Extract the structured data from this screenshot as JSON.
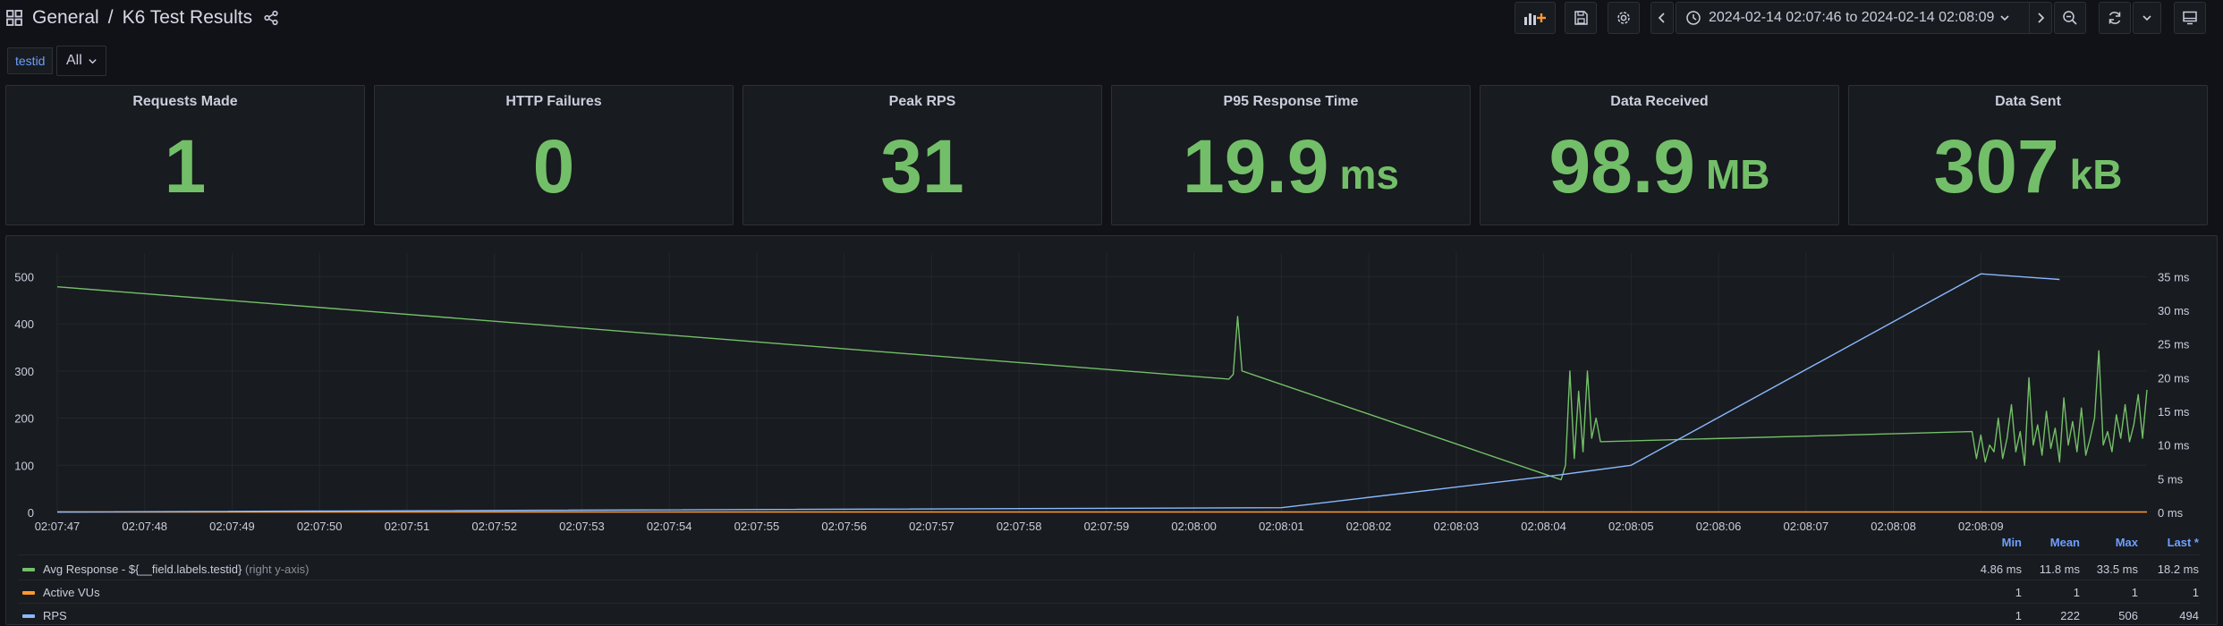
{
  "header": {
    "breadcrumb_folder": "General",
    "breadcrumb_sep": "/",
    "dashboard_title": "K6 Test Results",
    "icons": {
      "grid": "dashboard-grid-icon",
      "share": "share-icon",
      "add_panel": "add-panel-icon",
      "save": "save-icon",
      "settings": "gear-icon",
      "time_back": "chevron-left-icon",
      "clock": "clock-icon",
      "time_forward": "chevron-right-icon",
      "zoom_out": "zoom-out-icon",
      "refresh": "refresh-icon",
      "refresh_menu": "chevron-down-icon",
      "tv_mode": "monitor-icon"
    },
    "time_range": "2024-02-14 02:07:46 to 2024-02-14 02:08:09"
  },
  "variables": {
    "label": "testid",
    "selected": "All"
  },
  "stats": [
    {
      "title": "Requests Made",
      "value": "1",
      "unit": ""
    },
    {
      "title": "HTTP Failures",
      "value": "0",
      "unit": ""
    },
    {
      "title": "Peak RPS",
      "value": "31",
      "unit": ""
    },
    {
      "title": "P95 Response Time",
      "value": "19.9",
      "unit": "ms"
    },
    {
      "title": "Data Received",
      "value": "98.9",
      "unit": "MB"
    },
    {
      "title": "Data Sent",
      "value": "307",
      "unit": "kB"
    }
  ],
  "colors": {
    "green": "#73bf69",
    "blue": "#8ab8ff",
    "orange": "#ff9830",
    "accent": "#6e9fff"
  },
  "chart_data": {
    "type": "line",
    "x_ticks": [
      "02:07:47",
      "02:07:48",
      "02:07:49",
      "02:07:50",
      "02:07:51",
      "02:07:52",
      "02:07:53",
      "02:07:54",
      "02:07:55",
      "02:07:56",
      "02:07:57",
      "02:07:58",
      "02:07:59",
      "02:08:00",
      "02:08:01",
      "02:08:02",
      "02:08:03",
      "02:08:04",
      "02:08:05",
      "02:08:06",
      "02:08:07",
      "02:08:08",
      "02:08:09"
    ],
    "x_range_seconds": [
      47.0,
      70.9
    ],
    "left_axis": {
      "ticks": [
        "0",
        "100",
        "200",
        "300",
        "400",
        "500"
      ],
      "range": [
        0,
        550
      ]
    },
    "right_axis": {
      "ticks": [
        "0 ms",
        "5 ms",
        "10 ms",
        "15 ms",
        "20 ms",
        "25 ms",
        "30 ms",
        "35 ms"
      ],
      "range": [
        0,
        38.5
      ],
      "unit": "ms"
    },
    "grid": true,
    "legend_placement": "bottom",
    "legend_columns": [
      "Min",
      "Mean",
      "Max",
      "Last *"
    ],
    "series": [
      {
        "name": "Avg Response - ${__field.labels.testid}",
        "axis_hint": "(right y-axis)",
        "axis": "right",
        "color": "#73bf69",
        "stats": [
          "4.86 ms",
          "11.8 ms",
          "33.5 ms",
          "18.2 ms"
        ],
        "points": [
          [
            47.0,
            33.5
          ],
          [
            60.4,
            19.8
          ],
          [
            60.45,
            20.5
          ],
          [
            60.5,
            29.1
          ],
          [
            60.55,
            21.0
          ],
          [
            64.2,
            4.86
          ],
          [
            64.25,
            7.0
          ],
          [
            64.3,
            21.0
          ],
          [
            64.35,
            8.0
          ],
          [
            64.4,
            18.0
          ],
          [
            64.45,
            9.0
          ],
          [
            64.5,
            21.0
          ],
          [
            64.55,
            11.0
          ],
          [
            64.6,
            14.0
          ],
          [
            64.65,
            10.5
          ],
          [
            68.9,
            12.0
          ],
          [
            68.95,
            8.0
          ],
          [
            69.0,
            11.5
          ],
          [
            69.05,
            7.5
          ],
          [
            69.1,
            10.0
          ],
          [
            69.15,
            9.0
          ],
          [
            69.2,
            14.0
          ],
          [
            69.25,
            8.0
          ],
          [
            69.3,
            11.0
          ],
          [
            69.35,
            16.0
          ],
          [
            69.4,
            9.0
          ],
          [
            69.45,
            12.0
          ],
          [
            69.5,
            7.0
          ],
          [
            69.55,
            20.0
          ],
          [
            69.6,
            10.0
          ],
          [
            69.65,
            13.0
          ],
          [
            69.7,
            8.5
          ],
          [
            69.75,
            15.0
          ],
          [
            69.8,
            9.5
          ],
          [
            69.85,
            12.5
          ],
          [
            69.9,
            7.5
          ],
          [
            69.95,
            17.0
          ],
          [
            70.0,
            10.0
          ],
          [
            70.05,
            13.5
          ],
          [
            70.1,
            9.0
          ],
          [
            70.15,
            15.5
          ],
          [
            70.2,
            8.5
          ],
          [
            70.25,
            11.0
          ],
          [
            70.3,
            14.0
          ],
          [
            70.35,
            24.0
          ],
          [
            70.4,
            10.0
          ],
          [
            70.45,
            12.0
          ],
          [
            70.5,
            9.0
          ],
          [
            70.55,
            14.5
          ],
          [
            70.6,
            11.0
          ],
          [
            70.65,
            16.0
          ],
          [
            70.7,
            10.5
          ],
          [
            70.75,
            13.0
          ],
          [
            70.8,
            17.5
          ],
          [
            70.85,
            11.0
          ],
          [
            70.9,
            18.2
          ]
        ]
      },
      {
        "name": "Active VUs",
        "axis": "left",
        "color": "#ff9830",
        "stats": [
          "1",
          "1",
          "1",
          "1"
        ],
        "points": [
          [
            47.0,
            1
          ],
          [
            70.9,
            1
          ]
        ]
      },
      {
        "name": "RPS",
        "axis": "left",
        "color": "#8ab8ff",
        "stats": [
          "1",
          "222",
          "506",
          "494"
        ],
        "points": [
          [
            47.0,
            1
          ],
          [
            61.0,
            10
          ],
          [
            64.2,
            80
          ],
          [
            65.0,
            100
          ],
          [
            69.0,
            506
          ],
          [
            69.9,
            494
          ]
        ]
      }
    ]
  }
}
